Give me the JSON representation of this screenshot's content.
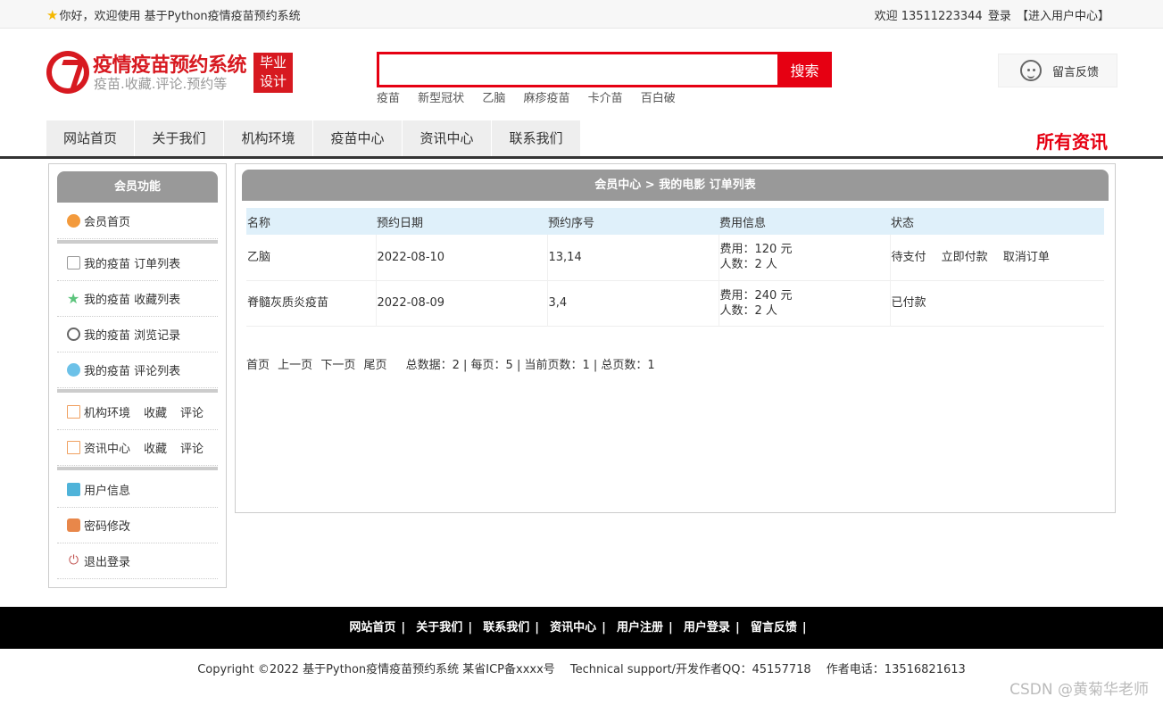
{
  "topbar": {
    "welcome_text": "你好，欢迎使用 基于Python疫情疫苗预约系统",
    "user_greeting": "欢迎 13511223344",
    "login_link": "登录",
    "user_center_link": "【进入用户中心】"
  },
  "header": {
    "logo_title": "疫情疫苗预约系统",
    "logo_subtitle": "疫苗.收藏.评论.预约等",
    "badge_line1": "毕业",
    "badge_line2": "设计",
    "search_button": "搜索",
    "search_value": "",
    "hotwords": [
      "疫苗",
      "新型冠状",
      "乙脑",
      "麻疹疫苗",
      "卡介苗",
      "百白破"
    ],
    "feedback_label": "留言反馈",
    "accent_color": "#e60012"
  },
  "nav": {
    "items": [
      "网站首页",
      "关于我们",
      "机构环境",
      "疫苗中心",
      "资讯中心",
      "联系我们"
    ],
    "right_title": "所有资讯"
  },
  "sidebar": {
    "title": "会员功能",
    "home": "会员首页",
    "orders": "我的疫苗 订单列表",
    "favorites": "我的疫苗 收藏列表",
    "history": "我的疫苗 浏览记录",
    "comments": "我的疫苗 评论列表",
    "env": {
      "label": "机构环境",
      "fav": "收藏",
      "comment": "评论"
    },
    "news": {
      "label": "资讯中心",
      "fav": "收藏",
      "comment": "评论"
    },
    "user_info": "用户信息",
    "password": "密码修改",
    "logout": "退出登录"
  },
  "main": {
    "breadcrumb": "会员中心 > 我的电影 订单列表",
    "columns": [
      "名称",
      "预约日期",
      "预约序号",
      "费用信息",
      "状态"
    ],
    "rows": [
      {
        "name": "乙脑",
        "date": "2022-08-10",
        "seq": "13,14",
        "fee": "费用：120 元",
        "people": "人数：2 人",
        "status": "待支付",
        "pay": "立即付款",
        "cancel": "取消订单"
      },
      {
        "name": "脊髓灰质炎疫苗",
        "date": "2022-08-09",
        "seq": "3,4",
        "fee": "费用：240 元",
        "people": "人数：2 人",
        "status": "已付款"
      }
    ],
    "pager": {
      "first": "首页",
      "prev": "上一页",
      "next": "下一页",
      "last": "尾页",
      "stats": "总数据：2 | 每页：5 | 当前页数：1 | 总页数：1"
    }
  },
  "footer": {
    "links": [
      "网站首页",
      "关于我们",
      "联系我们",
      "资讯中心",
      "用户注册",
      "用户登录",
      "留言反馈"
    ],
    "copyright": "Copyright ©2022 基于Python疫情疫苗预约系统 某省ICP备xxxx号　 Technical support/开发作者QQ：45157718　  作者电话：13516821613",
    "watermark": "CSDN @黄菊华老师"
  }
}
